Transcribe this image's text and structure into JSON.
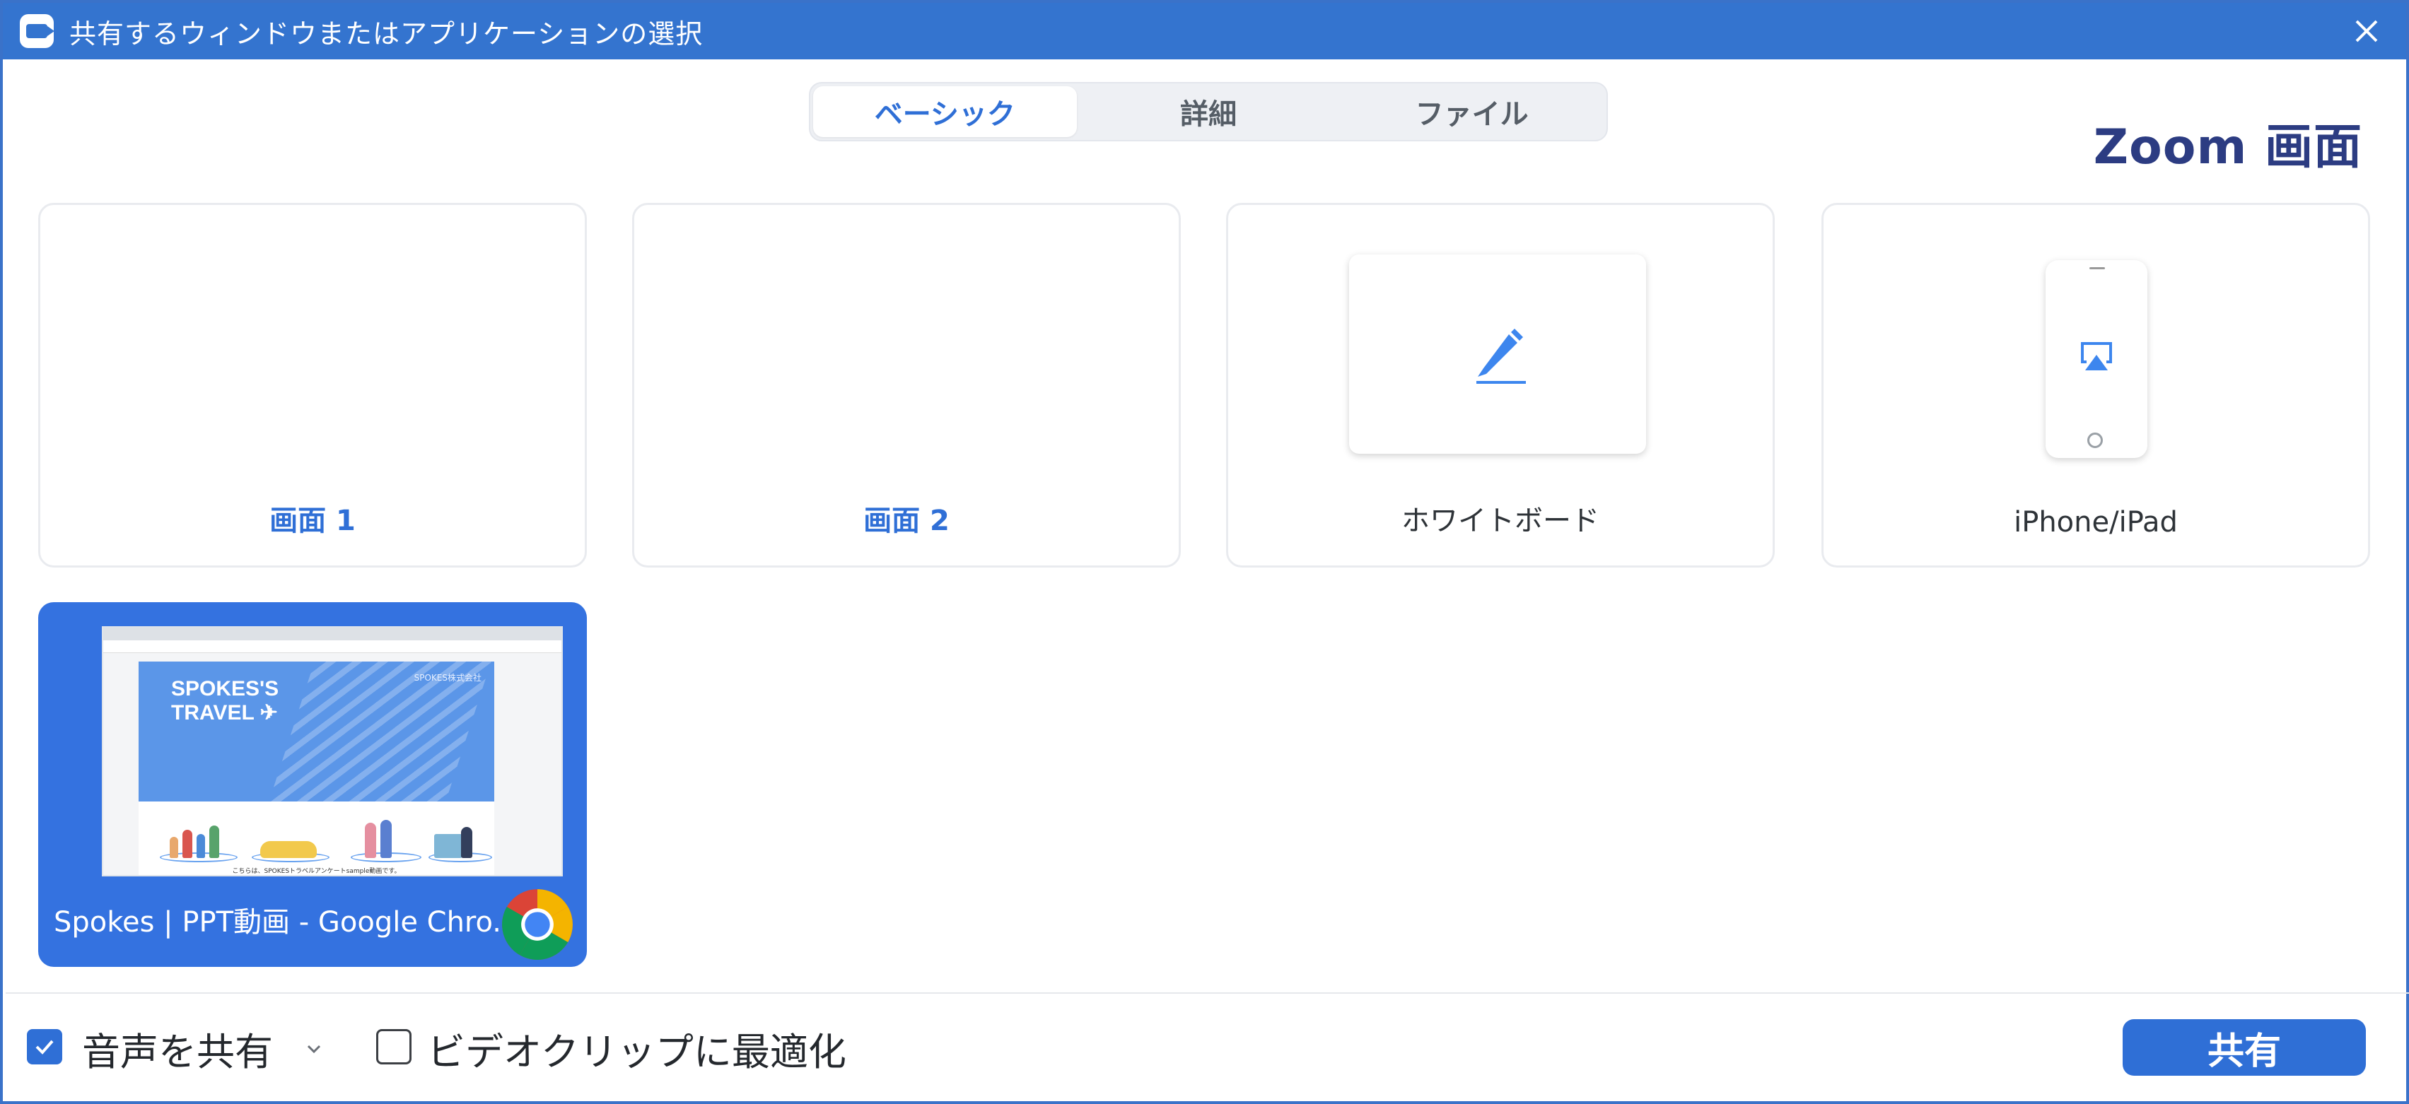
{
  "window": {
    "title": "共有するウィンドウまたはアプリケーションの選択",
    "accent_color": "#3474cf",
    "icons": {
      "app": "zoom-camera-icon",
      "close": "close-icon"
    }
  },
  "tabs": [
    {
      "label": "ベーシック",
      "active": true
    },
    {
      "label": "詳細",
      "active": false
    },
    {
      "label": "ファイル",
      "active": false
    }
  ],
  "zoom_label": "Zoom 画面",
  "cards": [
    {
      "label": "画面 1"
    },
    {
      "label": "画面 2"
    },
    {
      "label": "ホワイトボード",
      "icon": "pencil-icon"
    },
    {
      "label": "iPhone/iPad",
      "icon": "airplay-icon"
    }
  ],
  "window_card": {
    "label": "Spokes | PPT動画 - Google Chro...",
    "icon": "chrome-icon",
    "thumbnail": {
      "slide_title_line1": "SPOKES'S",
      "slide_title_line2": "TRAVEL",
      "slide_corp": "SPOKES株式会社",
      "caption": "こちらは、SPOKESトラベルアンケートsample動画です。"
    }
  },
  "footer": {
    "share_audio": {
      "label": "音声を共有",
      "checked": true
    },
    "optimize_video": {
      "label": "ビデオクリップに最適化",
      "checked": false
    },
    "share_button": "共有"
  }
}
